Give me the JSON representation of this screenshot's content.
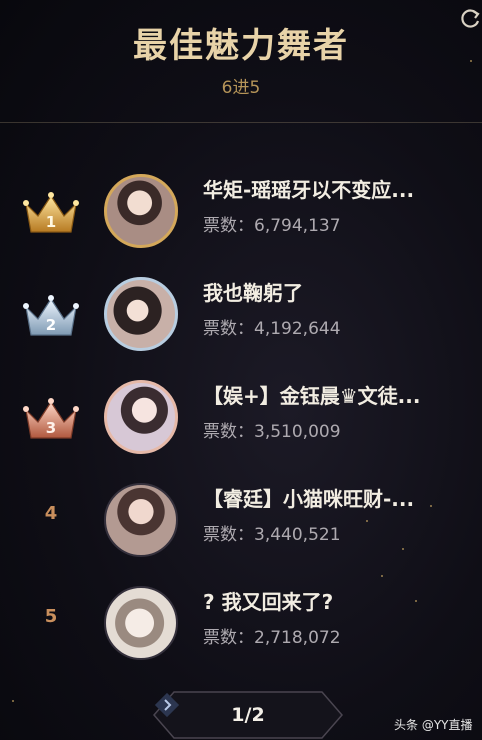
{
  "header": {
    "title": "最佳魅力舞者",
    "subtitle": "6进5"
  },
  "colors": {
    "gold": "#d4a85a",
    "silver": "#b8cde0",
    "bronze": "#e6b9a8",
    "rank_text": "#c98f5d"
  },
  "rankings": [
    {
      "rank": "1",
      "badge": "gold-crown-icon",
      "name": "华矩-瑶瑶牙以不变应...",
      "votes": "票数：6,794,137"
    },
    {
      "rank": "2",
      "badge": "silver-crown-icon",
      "name": "我也鞠躬了",
      "votes": "票数：4,192,644"
    },
    {
      "rank": "3",
      "badge": "bronze-crown-icon",
      "name": "【娱+】金钰晨♛文徒...",
      "votes": "票数：3,510,009"
    },
    {
      "rank": "4",
      "name": "【睿廷】小猫咪旺财-...",
      "votes": "票数：3,440,521"
    },
    {
      "rank": "5",
      "name": "? 我又回来了?",
      "votes": "票数：2,718,072"
    }
  ],
  "pagination": {
    "label": "1/2"
  },
  "watermark": "头条 @YY直播"
}
